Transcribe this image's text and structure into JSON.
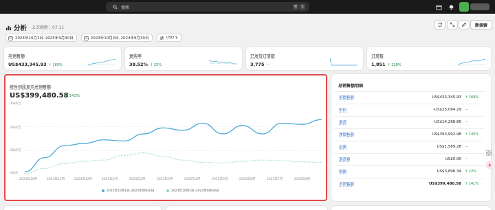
{
  "topbar": {
    "search_placeholder": "搜索",
    "shortcut_keys": [
      "⌘",
      "K"
    ]
  },
  "header": {
    "title": "分析",
    "last_updated": "上次刷新：07:11",
    "new_report_button": "新探索"
  },
  "filters": {
    "date_range": "2024年10月1日–2025年9月30日",
    "compare_range": "2023年10月2日–2024年9月30日",
    "currency": "USD $"
  },
  "metrics": [
    {
      "label": "毛销售额",
      "value": "US$433,345.93",
      "delta": "↑ 169%"
    },
    {
      "label": "复购率",
      "value": "38.52%",
      "delta": "↑ 25%"
    },
    {
      "label": "已发货订单数",
      "value": "3,775",
      "delta": "—"
    },
    {
      "label": "订单数",
      "value": "1,851",
      "delta": "↑ 228%"
    }
  ],
  "main_chart": {
    "label": "按时间段显示总销售额",
    "value": "US$399,480.58",
    "delta": "↑ 141%",
    "accent_color": "#4aa8d8",
    "compare_color": "#8fd3d0"
  },
  "chart_data": {
    "type": "line",
    "categories": [
      "2024年10月",
      "2024年11月",
      "2024年12月",
      "2025年1月",
      "2025年2月",
      "2025年3月",
      "2025年4月",
      "2025年5月",
      "2025年6月",
      "2025年7月",
      "2025年8月"
    ],
    "y_ticks": [
      "US$6万",
      "US$4万",
      "US$2万",
      "US$0"
    ],
    "ylim": [
      0,
      60000
    ],
    "series": [
      {
        "name": "2024年10月1日–2025年9月30日",
        "style": "solid",
        "values": [
          2000,
          14000,
          24000,
          26000,
          29000,
          28000,
          34000,
          39000,
          37000,
          43000,
          34000,
          41000,
          34000,
          43000,
          42000,
          46000
        ]
      },
      {
        "name": "2023年10月2日–2024年9月30日",
        "style": "dashed",
        "values": [
          500,
          5000,
          9000,
          11000,
          12000,
          16000,
          18000,
          15000,
          12000,
          10000,
          9500,
          11000,
          12000,
          11500,
          10500,
          10000
        ]
      }
    ],
    "grid": true,
    "legend_position": "bottom"
  },
  "breakdown": {
    "title": "总销售额明细",
    "rows": [
      {
        "label": "毛销售额",
        "value": "US$433,345.93",
        "delta": "↑ 169%"
      },
      {
        "label": "折扣",
        "value": "-US$25,084.29",
        "delta": "—"
      },
      {
        "label": "退货",
        "value": "-US$14,268.66",
        "delta": "—"
      },
      {
        "label": "净销售额",
        "value": "US$393,992.98",
        "delta": "↑ 145%"
      },
      {
        "label": "运费",
        "value": "US$1,589.28",
        "delta": "—"
      },
      {
        "label": "退货费",
        "value": "US$0.00",
        "delta": "—"
      },
      {
        "label": "税款",
        "value": "US$3,898.34",
        "delta": "↑ 22%"
      },
      {
        "label": "总销售额",
        "value": "US$399,480.58",
        "delta": "↑ 141%"
      }
    ]
  }
}
